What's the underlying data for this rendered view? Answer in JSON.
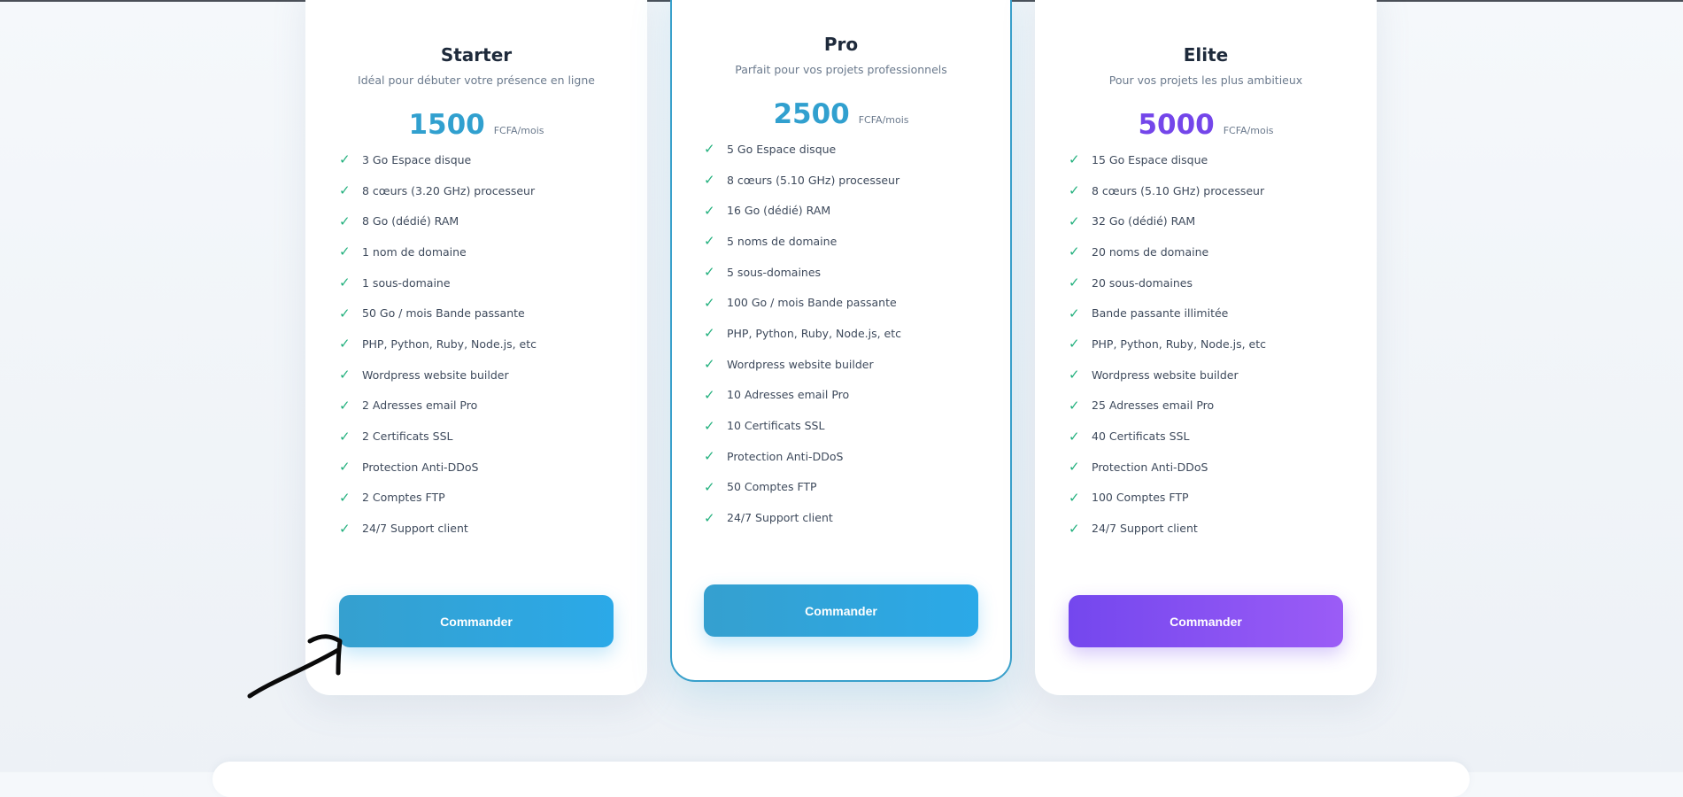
{
  "plans": [
    {
      "name": "Starter",
      "description": "Idéal pour débuter votre présence en ligne",
      "price": "1500",
      "period": "FCFA/mois",
      "price_color": "#31a0cf",
      "button_label": "Commander",
      "features": [
        "3 Go Espace disque",
        "8 cœurs (3.20 GHz) processeur",
        "8 Go (dédié) RAM",
        "1 nom de domaine",
        "1 sous-domaine",
        "50 Go / mois Bande passante",
        "PHP, Python, Ruby, Node.js, etc",
        "Wordpress website builder",
        "2 Adresses email Pro",
        "2 Certificats SSL",
        "Protection Anti-DDoS",
        "2 Comptes FTP",
        "24/7 Support client"
      ]
    },
    {
      "name": "Pro",
      "description": "Parfait pour vos projets professionnels",
      "price": "2500",
      "period": "FCFA/mois",
      "price_color": "#31a0cf",
      "button_label": "Commander",
      "features": [
        "5 Go Espace disque",
        "8 cœurs (5.10 GHz) processeur",
        "16 Go (dédié) RAM",
        "5 noms de domaine",
        "5 sous-domaines",
        "100 Go / mois Bande passante",
        "PHP, Python, Ruby, Node.js, etc",
        "Wordpress website builder",
        "10 Adresses email Pro",
        "10 Certificats SSL",
        "Protection Anti-DDoS",
        "50 Comptes FTP",
        "24/7 Support client"
      ]
    },
    {
      "name": "Elite",
      "description": "Pour vos projets les plus ambitieux",
      "price": "5000",
      "period": "FCFA/mois",
      "price_color": "#7446ea",
      "button_label": "Commander",
      "features": [
        "15 Go Espace disque",
        "8 cœurs (5.10 GHz) processeur",
        "32 Go (dédié) RAM",
        "20 noms de domaine",
        "20 sous-domaines",
        "Bande passante illimitée",
        "PHP, Python, Ruby, Node.js, etc",
        "Wordpress website builder",
        "25 Adresses email Pro",
        "40 Certificats SSL",
        "Protection Anti-DDoS",
        "100 Comptes FTP",
        "24/7 Support client"
      ]
    }
  ],
  "check_glyph": "✓",
  "accent_colors": {
    "check": "#22b07d",
    "pro_border": "#39a0cb"
  }
}
